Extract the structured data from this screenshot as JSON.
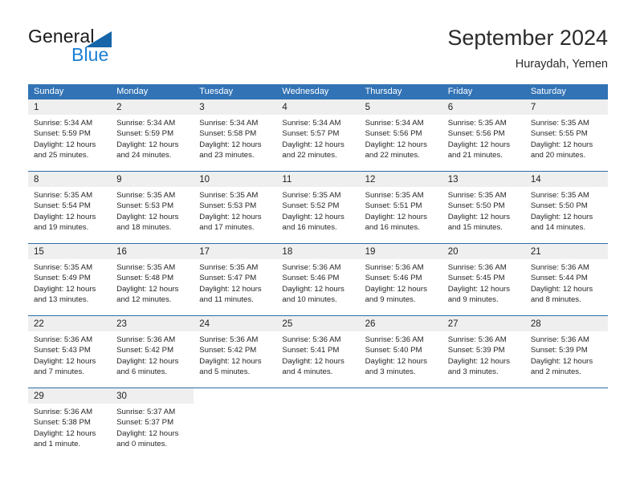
{
  "brand": {
    "name_part1": "General",
    "name_part2": "Blue",
    "triangle_color": "#1565a8",
    "blue_color": "#1b7fd4"
  },
  "header": {
    "title": "September 2024",
    "subtitle": "Huraydah, Yemen"
  },
  "theme": {
    "header_row_bg": "#3273b5",
    "week_divider": "#2f6ca8",
    "daynum_band_bg": "#efefef"
  },
  "weekdays": [
    "Sunday",
    "Monday",
    "Tuesday",
    "Wednesday",
    "Thursday",
    "Friday",
    "Saturday"
  ],
  "weeks": [
    [
      {
        "day": "1",
        "sunrise": "Sunrise: 5:34 AM",
        "sunset": "Sunset: 5:59 PM",
        "daylight1": "Daylight: 12 hours",
        "daylight2": "and 25 minutes."
      },
      {
        "day": "2",
        "sunrise": "Sunrise: 5:34 AM",
        "sunset": "Sunset: 5:59 PM",
        "daylight1": "Daylight: 12 hours",
        "daylight2": "and 24 minutes."
      },
      {
        "day": "3",
        "sunrise": "Sunrise: 5:34 AM",
        "sunset": "Sunset: 5:58 PM",
        "daylight1": "Daylight: 12 hours",
        "daylight2": "and 23 minutes."
      },
      {
        "day": "4",
        "sunrise": "Sunrise: 5:34 AM",
        "sunset": "Sunset: 5:57 PM",
        "daylight1": "Daylight: 12 hours",
        "daylight2": "and 22 minutes."
      },
      {
        "day": "5",
        "sunrise": "Sunrise: 5:34 AM",
        "sunset": "Sunset: 5:56 PM",
        "daylight1": "Daylight: 12 hours",
        "daylight2": "and 22 minutes."
      },
      {
        "day": "6",
        "sunrise": "Sunrise: 5:35 AM",
        "sunset": "Sunset: 5:56 PM",
        "daylight1": "Daylight: 12 hours",
        "daylight2": "and 21 minutes."
      },
      {
        "day": "7",
        "sunrise": "Sunrise: 5:35 AM",
        "sunset": "Sunset: 5:55 PM",
        "daylight1": "Daylight: 12 hours",
        "daylight2": "and 20 minutes."
      }
    ],
    [
      {
        "day": "8",
        "sunrise": "Sunrise: 5:35 AM",
        "sunset": "Sunset: 5:54 PM",
        "daylight1": "Daylight: 12 hours",
        "daylight2": "and 19 minutes."
      },
      {
        "day": "9",
        "sunrise": "Sunrise: 5:35 AM",
        "sunset": "Sunset: 5:53 PM",
        "daylight1": "Daylight: 12 hours",
        "daylight2": "and 18 minutes."
      },
      {
        "day": "10",
        "sunrise": "Sunrise: 5:35 AM",
        "sunset": "Sunset: 5:53 PM",
        "daylight1": "Daylight: 12 hours",
        "daylight2": "and 17 minutes."
      },
      {
        "day": "11",
        "sunrise": "Sunrise: 5:35 AM",
        "sunset": "Sunset: 5:52 PM",
        "daylight1": "Daylight: 12 hours",
        "daylight2": "and 16 minutes."
      },
      {
        "day": "12",
        "sunrise": "Sunrise: 5:35 AM",
        "sunset": "Sunset: 5:51 PM",
        "daylight1": "Daylight: 12 hours",
        "daylight2": "and 16 minutes."
      },
      {
        "day": "13",
        "sunrise": "Sunrise: 5:35 AM",
        "sunset": "Sunset: 5:50 PM",
        "daylight1": "Daylight: 12 hours",
        "daylight2": "and 15 minutes."
      },
      {
        "day": "14",
        "sunrise": "Sunrise: 5:35 AM",
        "sunset": "Sunset: 5:50 PM",
        "daylight1": "Daylight: 12 hours",
        "daylight2": "and 14 minutes."
      }
    ],
    [
      {
        "day": "15",
        "sunrise": "Sunrise: 5:35 AM",
        "sunset": "Sunset: 5:49 PM",
        "daylight1": "Daylight: 12 hours",
        "daylight2": "and 13 minutes."
      },
      {
        "day": "16",
        "sunrise": "Sunrise: 5:35 AM",
        "sunset": "Sunset: 5:48 PM",
        "daylight1": "Daylight: 12 hours",
        "daylight2": "and 12 minutes."
      },
      {
        "day": "17",
        "sunrise": "Sunrise: 5:35 AM",
        "sunset": "Sunset: 5:47 PM",
        "daylight1": "Daylight: 12 hours",
        "daylight2": "and 11 minutes."
      },
      {
        "day": "18",
        "sunrise": "Sunrise: 5:36 AM",
        "sunset": "Sunset: 5:46 PM",
        "daylight1": "Daylight: 12 hours",
        "daylight2": "and 10 minutes."
      },
      {
        "day": "19",
        "sunrise": "Sunrise: 5:36 AM",
        "sunset": "Sunset: 5:46 PM",
        "daylight1": "Daylight: 12 hours",
        "daylight2": "and 9 minutes."
      },
      {
        "day": "20",
        "sunrise": "Sunrise: 5:36 AM",
        "sunset": "Sunset: 5:45 PM",
        "daylight1": "Daylight: 12 hours",
        "daylight2": "and 9 minutes."
      },
      {
        "day": "21",
        "sunrise": "Sunrise: 5:36 AM",
        "sunset": "Sunset: 5:44 PM",
        "daylight1": "Daylight: 12 hours",
        "daylight2": "and 8 minutes."
      }
    ],
    [
      {
        "day": "22",
        "sunrise": "Sunrise: 5:36 AM",
        "sunset": "Sunset: 5:43 PM",
        "daylight1": "Daylight: 12 hours",
        "daylight2": "and 7 minutes."
      },
      {
        "day": "23",
        "sunrise": "Sunrise: 5:36 AM",
        "sunset": "Sunset: 5:42 PM",
        "daylight1": "Daylight: 12 hours",
        "daylight2": "and 6 minutes."
      },
      {
        "day": "24",
        "sunrise": "Sunrise: 5:36 AM",
        "sunset": "Sunset: 5:42 PM",
        "daylight1": "Daylight: 12 hours",
        "daylight2": "and 5 minutes."
      },
      {
        "day": "25",
        "sunrise": "Sunrise: 5:36 AM",
        "sunset": "Sunset: 5:41 PM",
        "daylight1": "Daylight: 12 hours",
        "daylight2": "and 4 minutes."
      },
      {
        "day": "26",
        "sunrise": "Sunrise: 5:36 AM",
        "sunset": "Sunset: 5:40 PM",
        "daylight1": "Daylight: 12 hours",
        "daylight2": "and 3 minutes."
      },
      {
        "day": "27",
        "sunrise": "Sunrise: 5:36 AM",
        "sunset": "Sunset: 5:39 PM",
        "daylight1": "Daylight: 12 hours",
        "daylight2": "and 3 minutes."
      },
      {
        "day": "28",
        "sunrise": "Sunrise: 5:36 AM",
        "sunset": "Sunset: 5:39 PM",
        "daylight1": "Daylight: 12 hours",
        "daylight2": "and 2 minutes."
      }
    ],
    [
      {
        "day": "29",
        "sunrise": "Sunrise: 5:36 AM",
        "sunset": "Sunset: 5:38 PM",
        "daylight1": "Daylight: 12 hours",
        "daylight2": "and 1 minute."
      },
      {
        "day": "30",
        "sunrise": "Sunrise: 5:37 AM",
        "sunset": "Sunset: 5:37 PM",
        "daylight1": "Daylight: 12 hours",
        "daylight2": "and 0 minutes."
      },
      {
        "day": "",
        "sunrise": "",
        "sunset": "",
        "daylight1": "",
        "daylight2": ""
      },
      {
        "day": "",
        "sunrise": "",
        "sunset": "",
        "daylight1": "",
        "daylight2": ""
      },
      {
        "day": "",
        "sunrise": "",
        "sunset": "",
        "daylight1": "",
        "daylight2": ""
      },
      {
        "day": "",
        "sunrise": "",
        "sunset": "",
        "daylight1": "",
        "daylight2": ""
      },
      {
        "day": "",
        "sunrise": "",
        "sunset": "",
        "daylight1": "",
        "daylight2": ""
      }
    ]
  ]
}
